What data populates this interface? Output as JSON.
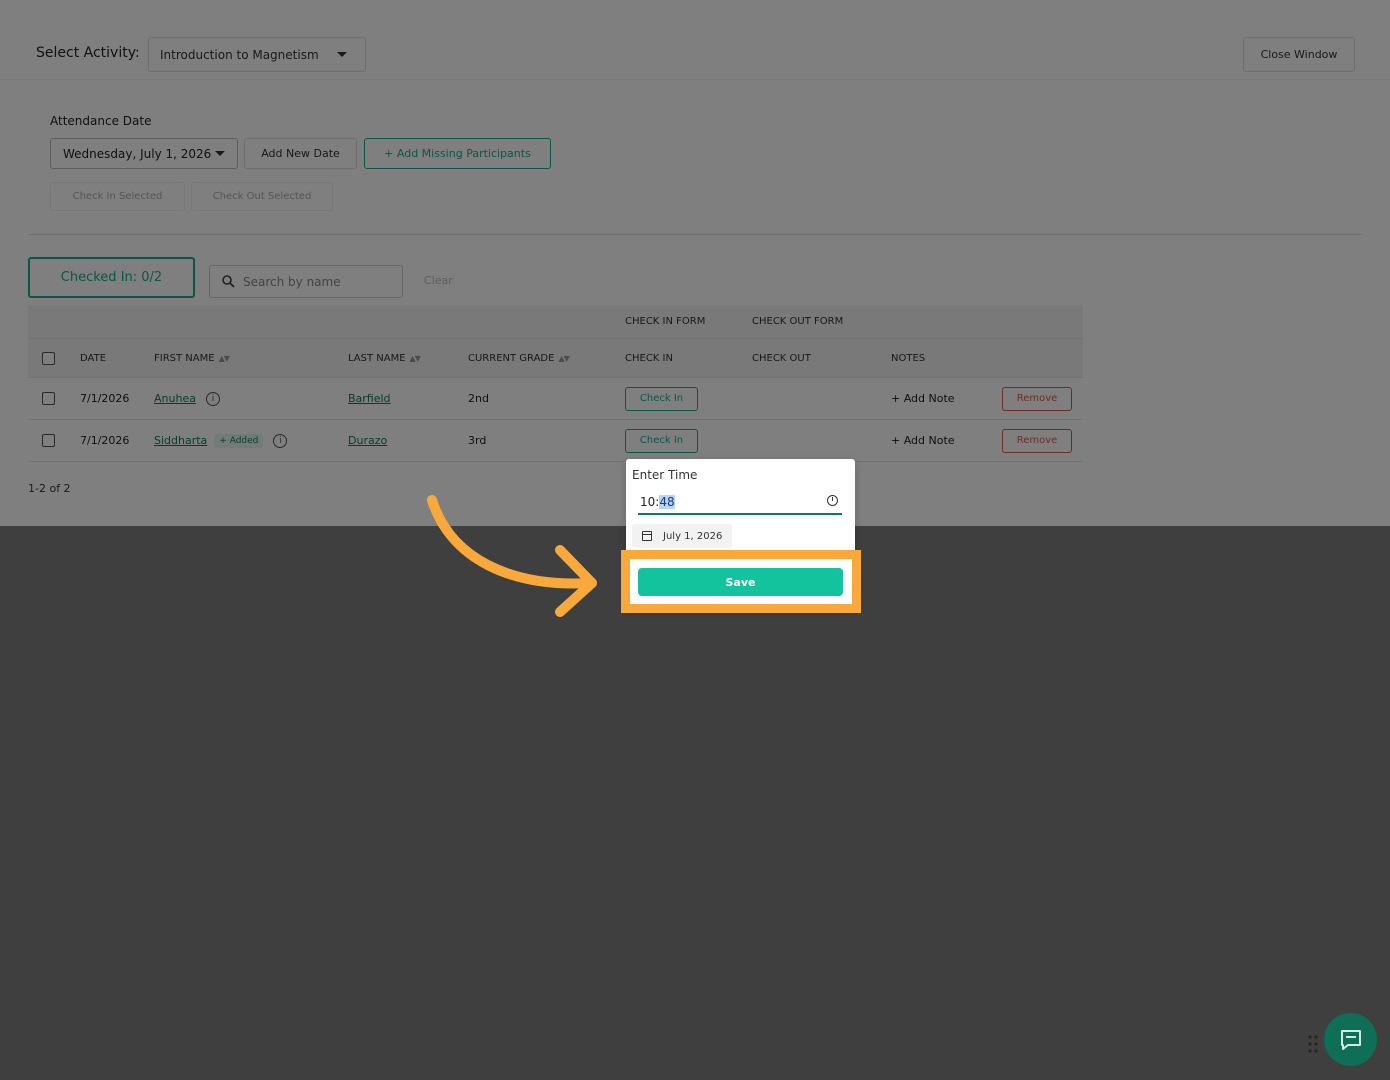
{
  "top": {
    "select_activity_label": "Select Activity:",
    "activity_value": "Introduction to Magnetism",
    "close_window": "Close Window"
  },
  "attendance": {
    "label": "Attendance Date",
    "date_value": "Wednesday, July 1, 2026",
    "add_new_date": "Add New Date",
    "add_missing": "+ Add Missing Participants",
    "check_in_selected": "Check In Selected",
    "check_out_selected": "Check Out Selected"
  },
  "summary": {
    "checked_in": "Checked In: 0/2",
    "search_placeholder": "Search by name",
    "clear": "Clear"
  },
  "table": {
    "group_headers": {
      "check_in_form": "CHECK IN FORM",
      "check_out_form": "CHECK OUT FORM"
    },
    "headers": {
      "date": "DATE",
      "first_name": "FIRST NAME",
      "last_name": "LAST NAME",
      "current_grade": "CURRENT GRADE",
      "check_in": "CHECK IN",
      "check_out": "CHECK OUT",
      "notes": "NOTES"
    },
    "sort_glyph": "▲▼",
    "rows": [
      {
        "date": "7/1/2026",
        "first_name": "Anuhea",
        "badge": "",
        "last_name": "Barfield",
        "grade": "2nd",
        "check_in": "Check In",
        "notes": "+ Add Note",
        "remove": "Remove"
      },
      {
        "date": "7/1/2026",
        "first_name": "Siddharta",
        "badge": "+ Added",
        "last_name": "Durazo",
        "grade": "3rd",
        "check_in": "Check In",
        "notes": "+ Add Note",
        "remove": "Remove"
      }
    ],
    "pagination": "1-2 of 2"
  },
  "popup": {
    "enter_time_label": "Enter Time",
    "time_hour": "10:",
    "time_minute": "48",
    "date_chip": "July 1, 2026",
    "save": "Save"
  },
  "icons": {
    "search": "search-icon",
    "info": "info-icon",
    "clock": "clock-icon",
    "calendar": "calendar-icon",
    "chat": "chat-icon",
    "arrow": "arrow-annotation-icon"
  },
  "colors": {
    "accent_green": "#12b08c",
    "save_button": "#12c39e",
    "remove_red": "#e05757",
    "highlight_orange": "#f9a93c",
    "chat_fab": "#0f6e58"
  }
}
